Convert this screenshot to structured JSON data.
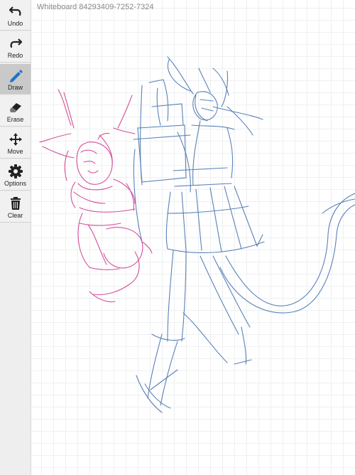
{
  "whiteboard": {
    "title": "Whiteboard 84293409-7252-7324"
  },
  "toolbar": {
    "items": [
      {
        "label": "Undo",
        "icon": "undo-icon"
      },
      {
        "label": "Redo",
        "icon": "redo-icon"
      },
      {
        "label": "Draw",
        "icon": "pencil-icon",
        "active": true
      },
      {
        "label": "Erase",
        "icon": "eraser-icon"
      },
      {
        "label": "Move",
        "icon": "move-icon"
      },
      {
        "label": "Options",
        "icon": "gear-icon"
      },
      {
        "label": "Clear",
        "icon": "trash-icon"
      }
    ]
  },
  "colors": {
    "pink_stroke": "#d0308a",
    "blue_stroke": "#3e6cab",
    "grid": "#eef0f1",
    "toolbar_bg": "#eeeeee",
    "active_tool_bg": "#c9c9c9"
  }
}
